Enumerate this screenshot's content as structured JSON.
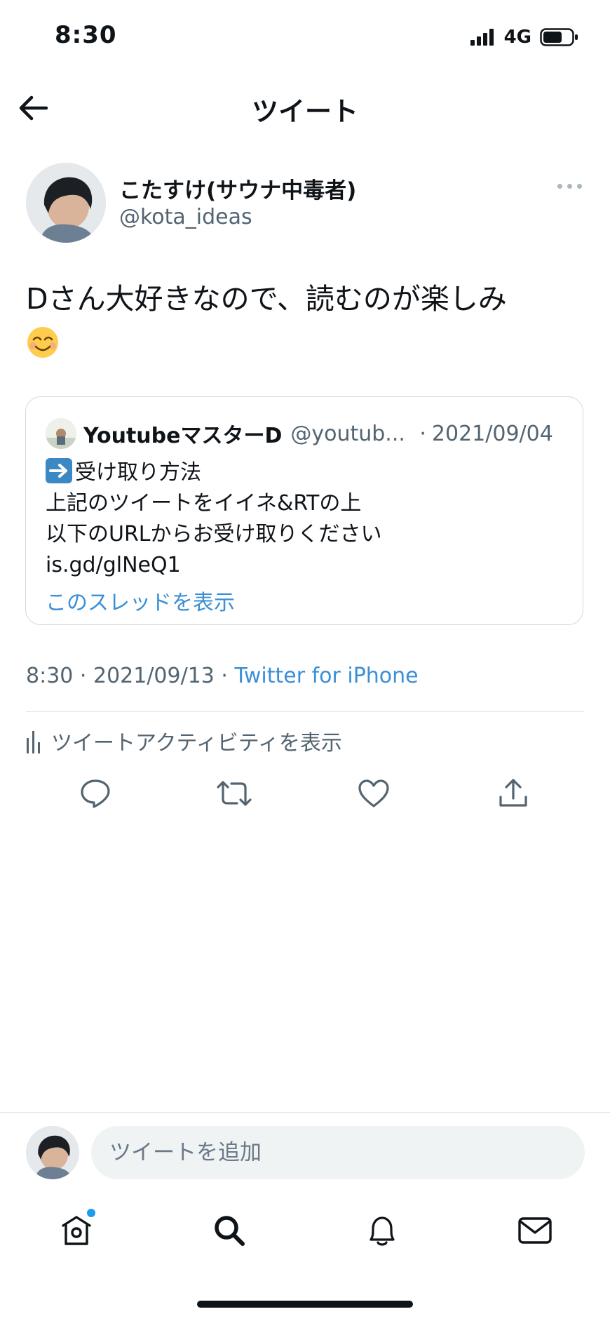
{
  "status_bar": {
    "time": "8:30",
    "network": "4G"
  },
  "header": {
    "title": "ツイート"
  },
  "tweet": {
    "author_name": "こたすけ(サウナ中毒者)",
    "author_handle": "@kota_ideas",
    "text": "Dさん大好きなので、読むのが楽しみ",
    "emoji": "smiling-face-emoji",
    "timestamp": "8:30 · 2021/09/13 · ",
    "source": "Twitter for iPhone",
    "activity_label": "ツイートアクティビティを表示"
  },
  "quote": {
    "author_name": "YoutubeマスターD",
    "author_handle": "@youtub...",
    "separator": "·",
    "date": "2021/09/04",
    "lines": [
      "受け取り方法",
      "上記のツイートをイイネ&RTの上",
      "以下のURLからお受け取りください",
      "is.gd/glNeQ1"
    ],
    "show_thread": "このスレッドを表示"
  },
  "reply": {
    "placeholder": "ツイートを追加"
  },
  "colors": {
    "accent": "#1d9bf0",
    "link": "#3b8fd6",
    "secondary_text": "#536471"
  },
  "icons": {
    "actions": [
      "reply-icon",
      "retweet-icon",
      "like-icon",
      "share-icon"
    ],
    "nav": [
      "home-icon",
      "search-icon",
      "notifications-icon",
      "messages-icon"
    ]
  }
}
